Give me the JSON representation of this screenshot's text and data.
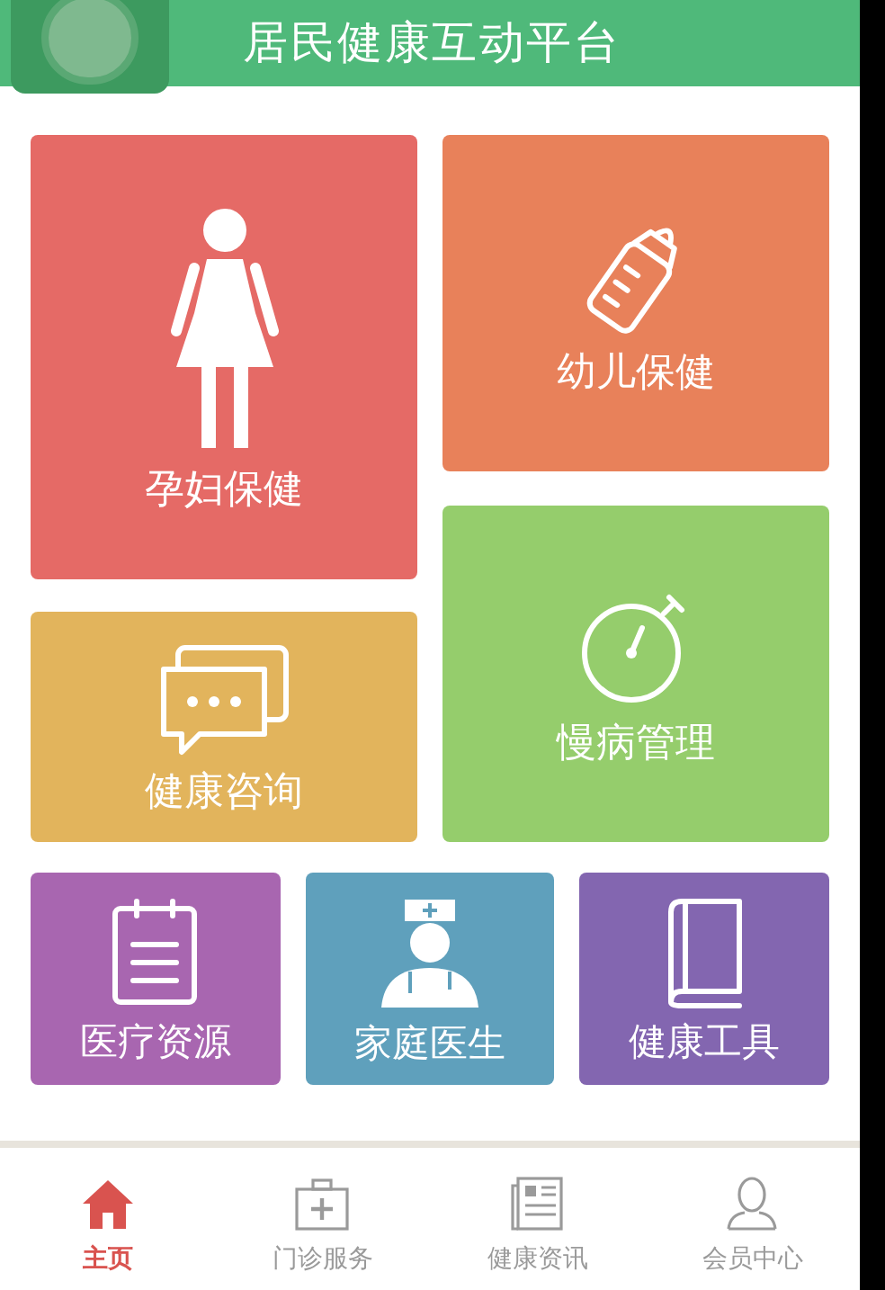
{
  "header": {
    "title": "居民健康互动平台"
  },
  "tiles": [
    {
      "label": "孕妇保健",
      "kind": "pregnant",
      "color": "#e56a66"
    },
    {
      "label": "幼儿保健",
      "kind": "bottle",
      "color": "#e8815a"
    },
    {
      "label": "健康咨询",
      "kind": "chat",
      "color": "#e2b45c"
    },
    {
      "label": "慢病管理",
      "kind": "stopwatch",
      "color": "#95cd6c"
    },
    {
      "label": "医疗资源",
      "kind": "clipboard",
      "color": "#a866b0"
    },
    {
      "label": "家庭医生",
      "kind": "doctor",
      "color": "#5fa0bc"
    },
    {
      "label": "健康工具",
      "kind": "book",
      "color": "#8366b0"
    }
  ],
  "nav": [
    {
      "label": "主页",
      "kind": "home",
      "selected": true
    },
    {
      "label": "门诊服务",
      "kind": "kit",
      "selected": false
    },
    {
      "label": "健康资讯",
      "kind": "news",
      "selected": false
    },
    {
      "label": "会员中心",
      "kind": "user",
      "selected": false
    }
  ]
}
